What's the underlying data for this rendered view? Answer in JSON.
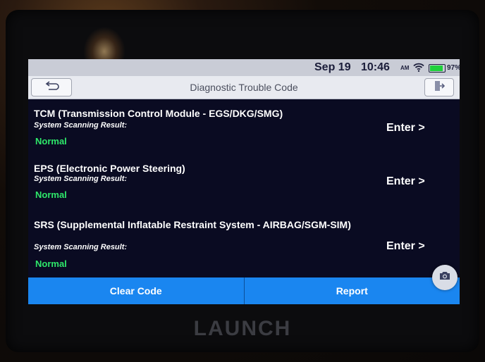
{
  "statusbar": {
    "date": "Sep 19",
    "time": "10:46",
    "ampm": "AM",
    "battery": "97%",
    "battery_level": 0.97,
    "icons": [
      "wifi-icon",
      "battery-icon"
    ]
  },
  "titlebar": {
    "title": "Diagnostic Trouble Code",
    "back_icon": "back-arrow-icon",
    "exit_icon": "exit-icon"
  },
  "systems": [
    {
      "name": "TCM (Transmission Control Module - EGS/DKG/SMG)",
      "label": "System Scanning Result:",
      "status": "Normal",
      "action": "Enter >"
    },
    {
      "name": "EPS (Electronic Power Steering)",
      "label": "System Scanning Result:",
      "status": "Normal",
      "action": "Enter >"
    },
    {
      "name": "SRS (Supplemental Inflatable Restraint System - AIRBAG/SGM-SIM)",
      "label": "System Scanning Result:",
      "status": "Normal",
      "action": "Enter >"
    }
  ],
  "bottom": {
    "clear_code": "Clear Code",
    "report": "Report"
  },
  "floating": {
    "icon": "camera-icon"
  },
  "device": {
    "brand": "LAUNCH"
  },
  "colors": {
    "accent": "#1a86f0",
    "status_ok": "#2ee86a",
    "screen_bg": "#0a0b22",
    "titlebar_bg": "#e8eaf0"
  }
}
